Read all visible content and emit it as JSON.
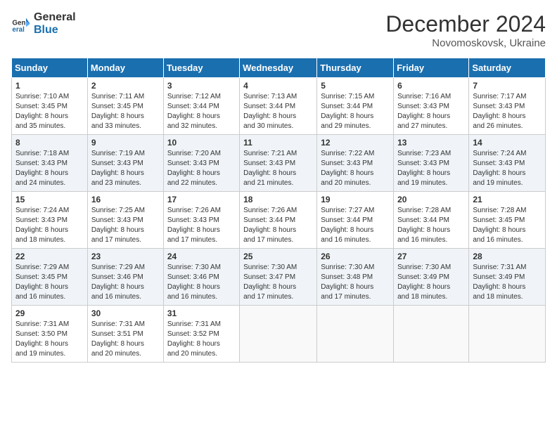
{
  "header": {
    "logo_line1": "General",
    "logo_line2": "Blue",
    "month_year": "December 2024",
    "location": "Novomoskovsk, Ukraine"
  },
  "weekdays": [
    "Sunday",
    "Monday",
    "Tuesday",
    "Wednesday",
    "Thursday",
    "Friday",
    "Saturday"
  ],
  "weeks": [
    [
      {
        "day": "1",
        "info": "Sunrise: 7:10 AM\nSunset: 3:45 PM\nDaylight: 8 hours\nand 35 minutes."
      },
      {
        "day": "2",
        "info": "Sunrise: 7:11 AM\nSunset: 3:45 PM\nDaylight: 8 hours\nand 33 minutes."
      },
      {
        "day": "3",
        "info": "Sunrise: 7:12 AM\nSunset: 3:44 PM\nDaylight: 8 hours\nand 32 minutes."
      },
      {
        "day": "4",
        "info": "Sunrise: 7:13 AM\nSunset: 3:44 PM\nDaylight: 8 hours\nand 30 minutes."
      },
      {
        "day": "5",
        "info": "Sunrise: 7:15 AM\nSunset: 3:44 PM\nDaylight: 8 hours\nand 29 minutes."
      },
      {
        "day": "6",
        "info": "Sunrise: 7:16 AM\nSunset: 3:43 PM\nDaylight: 8 hours\nand 27 minutes."
      },
      {
        "day": "7",
        "info": "Sunrise: 7:17 AM\nSunset: 3:43 PM\nDaylight: 8 hours\nand 26 minutes."
      }
    ],
    [
      {
        "day": "8",
        "info": "Sunrise: 7:18 AM\nSunset: 3:43 PM\nDaylight: 8 hours\nand 24 minutes."
      },
      {
        "day": "9",
        "info": "Sunrise: 7:19 AM\nSunset: 3:43 PM\nDaylight: 8 hours\nand 23 minutes."
      },
      {
        "day": "10",
        "info": "Sunrise: 7:20 AM\nSunset: 3:43 PM\nDaylight: 8 hours\nand 22 minutes."
      },
      {
        "day": "11",
        "info": "Sunrise: 7:21 AM\nSunset: 3:43 PM\nDaylight: 8 hours\nand 21 minutes."
      },
      {
        "day": "12",
        "info": "Sunrise: 7:22 AM\nSunset: 3:43 PM\nDaylight: 8 hours\nand 20 minutes."
      },
      {
        "day": "13",
        "info": "Sunrise: 7:23 AM\nSunset: 3:43 PM\nDaylight: 8 hours\nand 19 minutes."
      },
      {
        "day": "14",
        "info": "Sunrise: 7:24 AM\nSunset: 3:43 PM\nDaylight: 8 hours\nand 19 minutes."
      }
    ],
    [
      {
        "day": "15",
        "info": "Sunrise: 7:24 AM\nSunset: 3:43 PM\nDaylight: 8 hours\nand 18 minutes."
      },
      {
        "day": "16",
        "info": "Sunrise: 7:25 AM\nSunset: 3:43 PM\nDaylight: 8 hours\nand 17 minutes."
      },
      {
        "day": "17",
        "info": "Sunrise: 7:26 AM\nSunset: 3:43 PM\nDaylight: 8 hours\nand 17 minutes."
      },
      {
        "day": "18",
        "info": "Sunrise: 7:26 AM\nSunset: 3:44 PM\nDaylight: 8 hours\nand 17 minutes."
      },
      {
        "day": "19",
        "info": "Sunrise: 7:27 AM\nSunset: 3:44 PM\nDaylight: 8 hours\nand 16 minutes."
      },
      {
        "day": "20",
        "info": "Sunrise: 7:28 AM\nSunset: 3:44 PM\nDaylight: 8 hours\nand 16 minutes."
      },
      {
        "day": "21",
        "info": "Sunrise: 7:28 AM\nSunset: 3:45 PM\nDaylight: 8 hours\nand 16 minutes."
      }
    ],
    [
      {
        "day": "22",
        "info": "Sunrise: 7:29 AM\nSunset: 3:45 PM\nDaylight: 8 hours\nand 16 minutes."
      },
      {
        "day": "23",
        "info": "Sunrise: 7:29 AM\nSunset: 3:46 PM\nDaylight: 8 hours\nand 16 minutes."
      },
      {
        "day": "24",
        "info": "Sunrise: 7:30 AM\nSunset: 3:46 PM\nDaylight: 8 hours\nand 16 minutes."
      },
      {
        "day": "25",
        "info": "Sunrise: 7:30 AM\nSunset: 3:47 PM\nDaylight: 8 hours\nand 17 minutes."
      },
      {
        "day": "26",
        "info": "Sunrise: 7:30 AM\nSunset: 3:48 PM\nDaylight: 8 hours\nand 17 minutes."
      },
      {
        "day": "27",
        "info": "Sunrise: 7:30 AM\nSunset: 3:49 PM\nDaylight: 8 hours\nand 18 minutes."
      },
      {
        "day": "28",
        "info": "Sunrise: 7:31 AM\nSunset: 3:49 PM\nDaylight: 8 hours\nand 18 minutes."
      }
    ],
    [
      {
        "day": "29",
        "info": "Sunrise: 7:31 AM\nSunset: 3:50 PM\nDaylight: 8 hours\nand 19 minutes."
      },
      {
        "day": "30",
        "info": "Sunrise: 7:31 AM\nSunset: 3:51 PM\nDaylight: 8 hours\nand 20 minutes."
      },
      {
        "day": "31",
        "info": "Sunrise: 7:31 AM\nSunset: 3:52 PM\nDaylight: 8 hours\nand 20 minutes."
      },
      {
        "day": "",
        "info": ""
      },
      {
        "day": "",
        "info": ""
      },
      {
        "day": "",
        "info": ""
      },
      {
        "day": "",
        "info": ""
      }
    ]
  ]
}
